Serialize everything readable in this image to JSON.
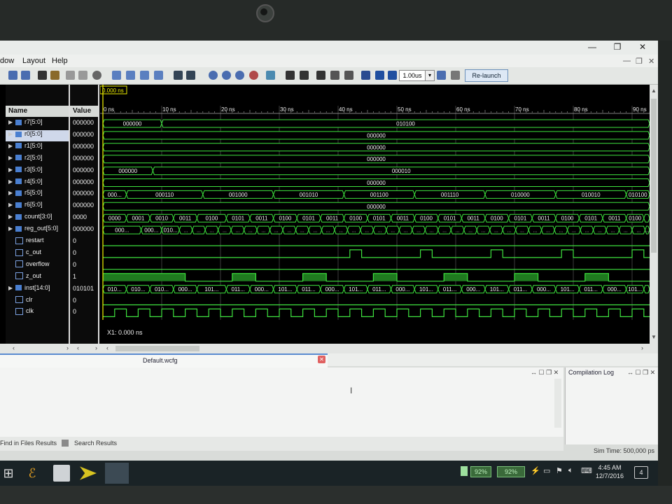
{
  "menu": {
    "window": "dow",
    "layout": "Layout",
    "help": "Help"
  },
  "toolbar": {
    "zoom_value": "1.00us",
    "relaunch_label": "Re-launch"
  },
  "waveform": {
    "cursor_time": "0.000 ns",
    "cursor_readout": "X1: 0.000 ns",
    "columns": {
      "name": "Name",
      "value": "Value"
    },
    "time_ticks": [
      "0 ns",
      "10 ns",
      "20 ns",
      "30 ns",
      "40 ns",
      "50 ns",
      "60 ns",
      "70 ns",
      "80 ns",
      "90 ns"
    ],
    "signals": [
      {
        "name": "r7[5:0]",
        "value": "000000",
        "kind": "bus",
        "segments": [
          [
            "000000",
            0,
            10
          ],
          [
            "010100",
            10,
            93
          ]
        ]
      },
      {
        "name": "r0[5:0]",
        "value": "000000",
        "kind": "bus",
        "selected": true,
        "segments": [
          [
            "000000",
            0,
            93
          ]
        ]
      },
      {
        "name": "r1[5:0]",
        "value": "000000",
        "kind": "bus",
        "segments": [
          [
            "000000",
            0,
            93
          ]
        ]
      },
      {
        "name": "r2[5:0]",
        "value": "000000",
        "kind": "bus",
        "segments": [
          [
            "000000",
            0,
            93
          ]
        ]
      },
      {
        "name": "r3[5:0]",
        "value": "000000",
        "kind": "bus",
        "segments": [
          [
            "000000",
            0,
            8.5
          ],
          [
            "000010",
            8.5,
            93
          ]
        ]
      },
      {
        "name": "r4[5:0]",
        "value": "000000",
        "kind": "bus",
        "segments": [
          [
            "000000",
            0,
            93
          ]
        ]
      },
      {
        "name": "r5[5:0]",
        "value": "000000",
        "kind": "bus",
        "segments": [
          [
            "000...",
            0,
            4
          ],
          [
            "000110",
            4,
            17
          ],
          [
            "001000",
            17,
            29
          ],
          [
            "001010",
            29,
            41
          ],
          [
            "001100",
            41,
            53
          ],
          [
            "001110",
            53,
            65
          ],
          [
            "010000",
            65,
            77
          ],
          [
            "010010",
            77,
            89
          ],
          [
            "010100",
            89,
            93
          ]
        ]
      },
      {
        "name": "r6[5:0]",
        "value": "000000",
        "kind": "bus",
        "segments": [
          [
            "000000",
            0,
            93
          ]
        ]
      },
      {
        "name": "count[3:0]",
        "value": "0000",
        "kind": "bus",
        "segments": [
          [
            "0000",
            0,
            4
          ],
          [
            "0001",
            4,
            8
          ],
          [
            "0010",
            8,
            12
          ],
          [
            "0011",
            12,
            16
          ],
          [
            "0100",
            16,
            21
          ],
          [
            "0101",
            21,
            25
          ],
          [
            "0011",
            25,
            29
          ],
          [
            "0100",
            29,
            33
          ],
          [
            "0101",
            33,
            37
          ],
          [
            "0011",
            37,
            41
          ],
          [
            "0100",
            41,
            45
          ],
          [
            "0101",
            45,
            49
          ],
          [
            "0011",
            49,
            53
          ],
          [
            "0100",
            53,
            57
          ],
          [
            "0101",
            57,
            61
          ],
          [
            "0011",
            61,
            65
          ],
          [
            "0100",
            65,
            69
          ],
          [
            "0101",
            69,
            73
          ],
          [
            "0011",
            73,
            77
          ],
          [
            "0100",
            77,
            81
          ],
          [
            "0101",
            81,
            85
          ],
          [
            "0011",
            85,
            89
          ],
          [
            "0100",
            89,
            92
          ],
          [
            "0...",
            92,
            93
          ]
        ]
      },
      {
        "name": "reg_out[5:0]",
        "value": "000000",
        "kind": "bus",
        "segments": [
          [
            "000...",
            0,
            6.5
          ],
          [
            "000...",
            6.5,
            10
          ],
          [
            "010...",
            10,
            13
          ]
        ]
      },
      {
        "name": "restart",
        "value": "0",
        "kind": "bit"
      },
      {
        "name": "c_out",
        "value": "0",
        "kind": "bit"
      },
      {
        "name": "overflow",
        "value": "0",
        "kind": "bit"
      },
      {
        "name": "z_out",
        "value": "1",
        "kind": "bit"
      },
      {
        "name": "inst[14:0]",
        "value": "010101",
        "kind": "bus",
        "segments": [
          [
            "010...",
            0,
            4
          ],
          [
            "010...",
            4,
            8
          ],
          [
            "010...",
            8,
            12
          ],
          [
            "000...",
            12,
            16
          ],
          [
            "101...",
            16,
            21
          ],
          [
            "011...",
            21,
            25
          ],
          [
            "000...",
            25,
            29
          ],
          [
            "101...",
            29,
            33
          ],
          [
            "011...",
            33,
            37
          ],
          [
            "000...",
            37,
            41
          ],
          [
            "101...",
            41,
            45
          ],
          [
            "011...",
            45,
            49
          ],
          [
            "000...",
            49,
            53
          ],
          [
            "101...",
            53,
            57
          ],
          [
            "011...",
            57,
            61
          ],
          [
            "000...",
            61,
            65
          ],
          [
            "101...",
            65,
            69
          ],
          [
            "011...",
            69,
            73
          ],
          [
            "000...",
            73,
            77
          ],
          [
            "101...",
            77,
            81
          ],
          [
            "011...",
            81,
            85
          ],
          [
            "000...",
            85,
            89
          ],
          [
            "101...",
            89,
            92
          ],
          [
            "0...",
            92,
            93
          ]
        ]
      },
      {
        "name": "clr",
        "value": "0",
        "kind": "bit"
      },
      {
        "name": "clk",
        "value": "0",
        "kind": "bit"
      }
    ]
  },
  "tabs": {
    "wave_tab": "Default.wcfg"
  },
  "panels": {
    "compilation_log": "Compilation Log",
    "find_in_files": "Find in Files Results",
    "search_results": "Search Results",
    "sim_time": "Sim Time: 500,000 ps"
  },
  "taskbar": {
    "battery1": "92%",
    "battery2": "92%",
    "time": "4:45 AM",
    "date": "12/7/2016",
    "notifications": "4"
  },
  "colors": {
    "wave": "#3ee23e",
    "wave_dark": "#1f7a1f",
    "bus_fill": "#000000",
    "cursor": "#f2f200",
    "selection": "#cfd8ea",
    "background": "#000000"
  }
}
